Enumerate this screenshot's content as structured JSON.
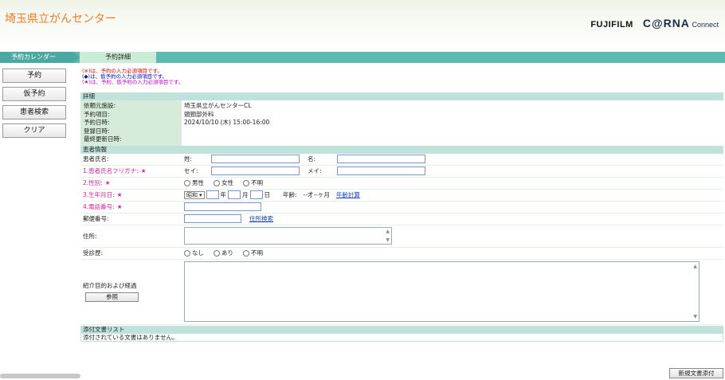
{
  "header": {
    "title": "埼玉県立がんセンター",
    "brand_fuji": "FUJIFILM",
    "brand_carna": "C@RNA",
    "brand_connect": "Connect"
  },
  "breadcrumb": {
    "step1": "予約カレンダー",
    "step2": "予約詳細"
  },
  "sidebar": {
    "items": [
      {
        "label": "予約"
      },
      {
        "label": "仮予約"
      },
      {
        "label": "患者検索"
      },
      {
        "label": "クリア"
      }
    ]
  },
  "notes": {
    "line1": "(※)は、予約の入力必須項目です。",
    "line2": "(◆)は、仮予約の入力必須項目です。",
    "line3": "(★)は、予約、仮予約の入力必須項目です。"
  },
  "details": {
    "heading": "詳細",
    "labels": [
      "依頼元施設:",
      "予約項目:",
      "予約日時:",
      "登録日時:",
      "最終更新日時:"
    ],
    "values": [
      "埼玉県立がんセンターCL",
      "頭頸部外科",
      "2024/10/10 (木) 15:00-16:00",
      "",
      ""
    ]
  },
  "patient": {
    "heading": "患者情報",
    "name_label": "患者氏名:",
    "sei_label": "姓:",
    "mei_label": "名:",
    "kana_label": "1.患者氏名フリガナ:",
    "kana_sei_label": "セイ:",
    "kana_mei_label": "メイ:",
    "gender_label": "2.性別:",
    "gender_options": [
      "男性",
      "女性",
      "不明"
    ],
    "dob_label": "3.生年月日:",
    "era_value": "昭和",
    "year_suffix": "年",
    "month_suffix": "月",
    "day_suffix": "日",
    "age_label": "年齢:",
    "age_value": "--才--ヶ月",
    "age_calc_link": "年齢計算",
    "phone_label": "4.電話番号:",
    "postal_label": "郵便番号:",
    "address_search_link": "住所検索",
    "address_label": "住所:",
    "visit_history_label": "受診歴:",
    "visit_options": [
      "なし",
      "あり",
      "不明"
    ],
    "referral_label": "紹介目的および経過",
    "reference_button": "参照"
  },
  "attachments": {
    "heading": "添付文書リスト",
    "empty_text": "添付されている文書はありません。",
    "new_doc_button": "新規文書添付"
  },
  "star_symbol": "★",
  "colors": {
    "title": "#f27a1e",
    "teal": "#5dbab0",
    "required": "#dd2299"
  }
}
